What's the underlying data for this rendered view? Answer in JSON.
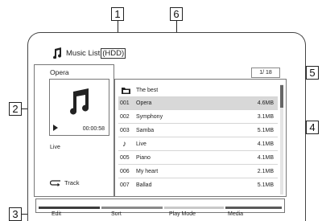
{
  "callouts": {
    "c1": "1",
    "c2": "2",
    "c3": "3",
    "c4": "4",
    "c5": "5",
    "c6": "6"
  },
  "header": {
    "title": "Music List",
    "device": "(HDD)",
    "icon": "music-note-icon"
  },
  "info": {
    "album": "Opera",
    "time": "00:00:58",
    "genre": "Live",
    "repeat_label": "Track",
    "art_icon": "music-note-icon"
  },
  "page_indicator": "1/ 18",
  "list": {
    "folder": {
      "name": "The best",
      "icon": "folder-icon"
    },
    "tracks": [
      {
        "num": "001",
        "name": "Opera",
        "size": "4.6MB",
        "selected": true
      },
      {
        "num": "002",
        "name": "Symphony",
        "size": "3.1MB"
      },
      {
        "num": "003",
        "name": "Samba",
        "size": "5.1MB"
      },
      {
        "num": "",
        "name": "Live",
        "size": "4.1MB",
        "icon": "music-note-icon"
      },
      {
        "num": "005",
        "name": "Piano",
        "size": "4.1MB"
      },
      {
        "num": "006",
        "name": "My heart",
        "size": "2.1MB"
      },
      {
        "num": "007",
        "name": "Ballad",
        "size": "5.1MB"
      }
    ]
  },
  "color_buttons": [
    {
      "label": "Edit",
      "color": "#3d3d3d"
    },
    {
      "label": "Sort",
      "color": "#8a8a8a"
    },
    {
      "label": "Play Mode",
      "color": "#c9c9c9"
    },
    {
      "label": "Media",
      "color": "#5a5a5a"
    }
  ]
}
